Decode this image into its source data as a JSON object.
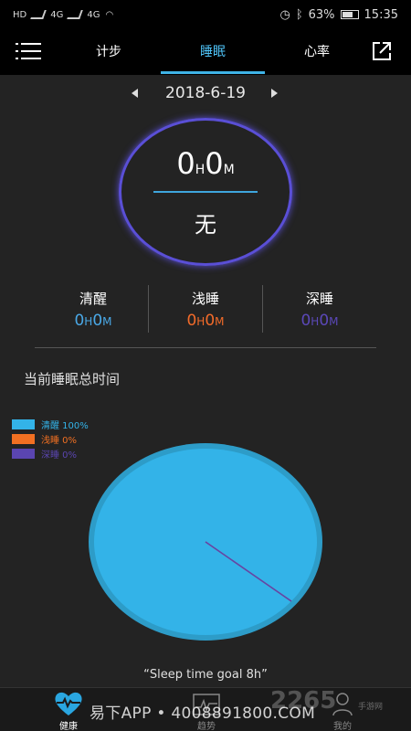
{
  "status_bar": {
    "left_indicators": [
      "HD",
      "4G",
      "4G"
    ],
    "battery": "63%",
    "time": "15:35"
  },
  "header": {
    "tabs": [
      {
        "label": "计步"
      },
      {
        "label": "睡眠",
        "active": true
      },
      {
        "label": "心率"
      }
    ],
    "accent_color": "#3fb3e6",
    "icons": {
      "menu": "menu-icon",
      "share": "share-icon"
    }
  },
  "date_nav": {
    "date": "2018-6-19"
  },
  "summary": {
    "hours": "0",
    "hours_unit": "H",
    "minutes": "0",
    "minutes_unit": "M",
    "quality": "无"
  },
  "stats": [
    {
      "label": "清醒",
      "hours": "0",
      "minutes": "0",
      "h_unit": "H",
      "m_unit": "M",
      "color": "#4aa8e6"
    },
    {
      "label": "浅睡",
      "hours": "0",
      "minutes": "0",
      "h_unit": "H",
      "m_unit": "M",
      "color": "#f26b2a"
    },
    {
      "label": "深睡",
      "hours": "0",
      "minutes": "0",
      "h_unit": "H",
      "m_unit": "M",
      "color": "#5b48b8"
    }
  ],
  "section_title": "当前睡眠总时间",
  "chart_data": {
    "type": "pie",
    "labels": [
      "清醒 100%",
      "浅睡 0%",
      "深睡 0%"
    ],
    "categories": [
      "清醒",
      "浅睡",
      "深睡"
    ],
    "values": [
      100,
      0,
      0
    ],
    "colors": [
      "#33b3e8",
      "#f27022",
      "#5a45b0"
    ],
    "legend": "top-left"
  },
  "goal_text": "“Sleep time goal 8h”",
  "bottom_nav": {
    "items": [
      {
        "label": "健康",
        "icon": "heart-pulse-icon",
        "active": true
      },
      {
        "label": "趋势",
        "icon": "trend-icon"
      },
      {
        "label": "我的",
        "icon": "person-icon"
      }
    ]
  },
  "watermark": {
    "text": "易下APP • 4008891800.COM",
    "logo": "2265",
    "sub": "手游网"
  }
}
